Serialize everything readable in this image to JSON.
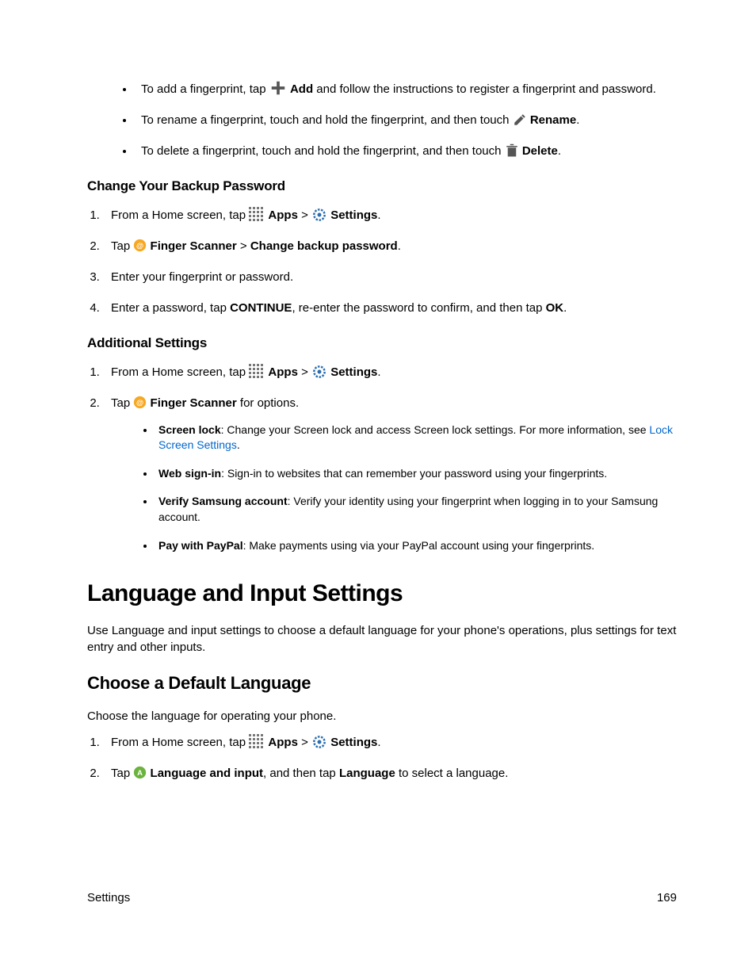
{
  "fp_actions": {
    "add_pre": "To add a fingerprint, tap",
    "add_label": "Add",
    "add_post": "and follow the instructions to register a fingerprint and password.",
    "rename_pre": "To rename a fingerprint, touch and hold the fingerprint, and then touch",
    "rename_label": "Rename",
    "delete_pre": "To delete a fingerprint, touch and hold the fingerprint, and then touch",
    "delete_label": "Delete"
  },
  "h_backup": "Change Your Backup Password",
  "nav": {
    "from_home": "From a Home screen, tap",
    "apps": "Apps",
    "settings": "Settings",
    "sep": ">",
    "tap": "Tap",
    "finger_scanner": "Finger Scanner",
    "change_backup": "Change backup password",
    "for_options": "for options."
  },
  "steps_backup": {
    "s3": "Enter your fingerprint or password.",
    "s4_pre": "Enter a password, tap ",
    "s4_cont": "CONTINUE",
    "s4_mid": ", re-enter the password to confirm, and then tap ",
    "s4_ok": "OK",
    "period": "."
  },
  "h_additional": "Additional Settings",
  "opts": {
    "screen_lock_label": "Screen lock",
    "screen_lock_text": ": Change your Screen lock and access Screen lock settings. For more information, see ",
    "screen_lock_link": "Lock Screen Settings",
    "web_signin_label": "Web sign-in",
    "web_signin_text": ": Sign-in to websites that can remember your password using your fingerprints.",
    "verify_label": "Verify Samsung account",
    "verify_text": ": Verify your identity using your fingerprint when logging in to your Samsung account.",
    "paypal_label": "Pay with PayPal",
    "paypal_text": ": Make payments using via your PayPal account using your fingerprints."
  },
  "h_lang": "Language and Input Settings",
  "lang_intro": "Use Language and input settings to choose a default language for your phone's operations, plus settings for text entry and other inputs.",
  "h_choose": "Choose a Default Language",
  "choose_intro": "Choose the language for operating your phone.",
  "lang_step2": {
    "tap": "Tap",
    "label": "Language and input",
    "mid": ", and then tap ",
    "lang": "Language",
    "post": " to select a language."
  },
  "footer": {
    "section": "Settings",
    "pageno": "169"
  }
}
